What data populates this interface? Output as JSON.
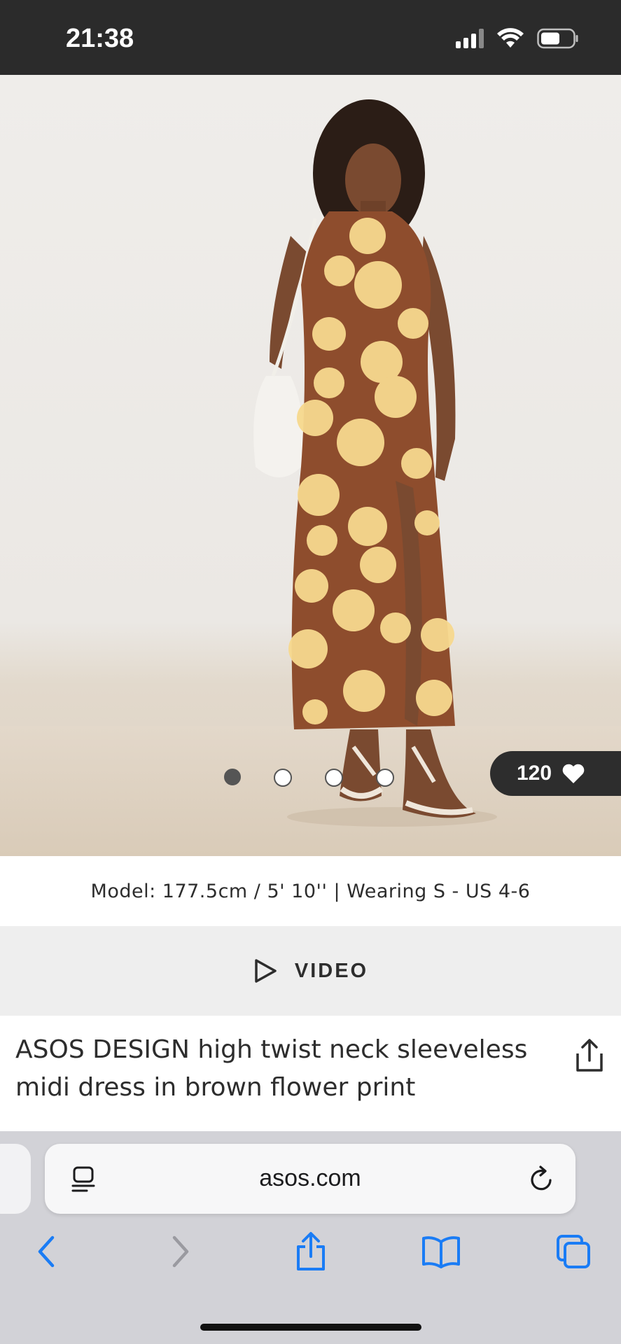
{
  "status_bar": {
    "time": "21:38"
  },
  "product": {
    "likes": "120",
    "image_count": 4,
    "active_image": 1,
    "model_info": "Model: 177.5cm / 5' 10'' | Wearing S - US 4-6",
    "video_label": "VIDEO",
    "title": "ASOS DESIGN high twist neck sleeveless midi dress in brown flower print"
  },
  "browser": {
    "url": "asos.com",
    "accent_color": "#1a7cf5"
  },
  "icons": {
    "reader": "reader-icon",
    "reload": "reload-icon",
    "back": "chevron-left-icon",
    "forward": "chevron-right-icon",
    "share": "share-icon",
    "bookmarks": "book-icon",
    "tabs": "tabs-icon",
    "like": "heart-icon",
    "play": "play-icon"
  }
}
